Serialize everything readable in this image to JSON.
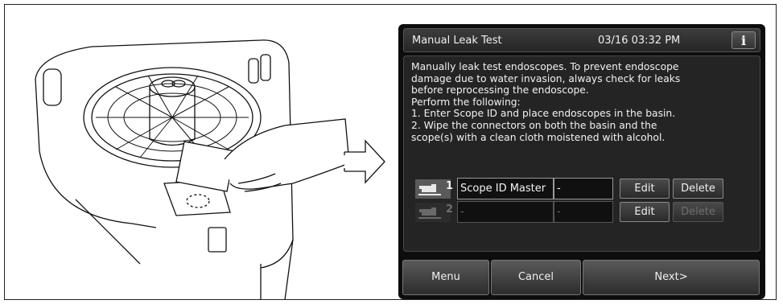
{
  "screen": {
    "title": "Manual Leak Test",
    "datetime": "03/16 03:32 PM",
    "info_glyph": "i",
    "info_icon": "info-icon",
    "message_lines": [
      "Manually leak test endoscopes. To prevent endoscope",
      "damage due to water invasion, always check for leaks",
      "before reprocessing the endoscope.",
      "Perform the following:",
      "1. Enter Scope ID and place endoscopes in the basin.",
      "2. Wipe the connectors on both the basin and the",
      "scope(s) with a clean cloth moistened with alcohol."
    ],
    "scopes": [
      {
        "number": "1",
        "scope_id": "Scope ID Master",
        "value": "-",
        "edit_label": "Edit",
        "delete_label": "Delete",
        "active": true
      },
      {
        "number": "2",
        "scope_id": "-",
        "value": "-",
        "edit_label": "Edit",
        "delete_label": "Delete",
        "active": false
      }
    ],
    "nav": {
      "menu": "Menu",
      "cancel": "Cancel",
      "next": "Next>"
    }
  },
  "colors": {
    "screen_bg": "#0d0d0d",
    "panel_bg": "#242424",
    "text": "#f2f2f2",
    "disabled": "#6e6e6e"
  }
}
